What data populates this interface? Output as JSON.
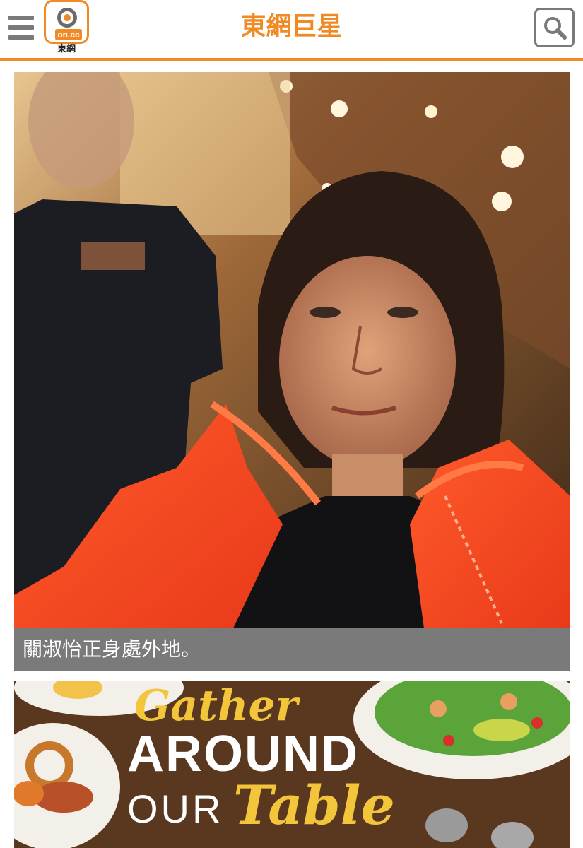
{
  "header": {
    "menu_icon": "hamburger-menu-icon",
    "logo": {
      "badge_text": "on.cc",
      "label": "東網"
    },
    "title": "東網巨星",
    "search_icon": "search-icon"
  },
  "article": {
    "photo_caption": "關淑怡正身處外地。",
    "second_photo": {
      "line1": "Gather",
      "line2": "AROUND",
      "line3": "OUR",
      "line4": "Table"
    }
  },
  "colors": {
    "accent": "#f08a24",
    "icon_gray": "#7a7a7a",
    "caption_bg": "#7a7a7a"
  }
}
